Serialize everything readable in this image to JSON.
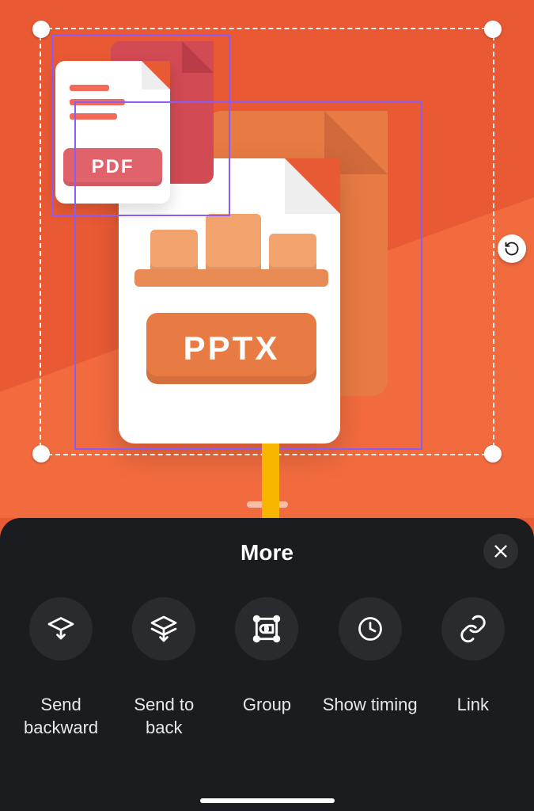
{
  "canvas": {
    "elements": {
      "pdf": {
        "badge": "PDF"
      },
      "pptx": {
        "badge": "PPTX"
      }
    }
  },
  "sheet": {
    "title": "More",
    "actions": [
      {
        "id": "send-backward",
        "label": "Send\nbackward",
        "icon": "send-backward-icon"
      },
      {
        "id": "send-to-back",
        "label": "Send to\nback",
        "icon": "send-to-back-icon"
      },
      {
        "id": "group",
        "label": "Group",
        "icon": "group-icon"
      },
      {
        "id": "show-timing",
        "label": "Show timing",
        "icon": "clock-icon"
      },
      {
        "id": "link",
        "label": "Link",
        "icon": "link-icon"
      }
    ]
  },
  "colors": {
    "canvas_bg": "#e85a34",
    "selection_accent": "#8b5cf6",
    "annotation_arrow": "#f7b500",
    "sheet_bg": "#1b1c1f"
  }
}
